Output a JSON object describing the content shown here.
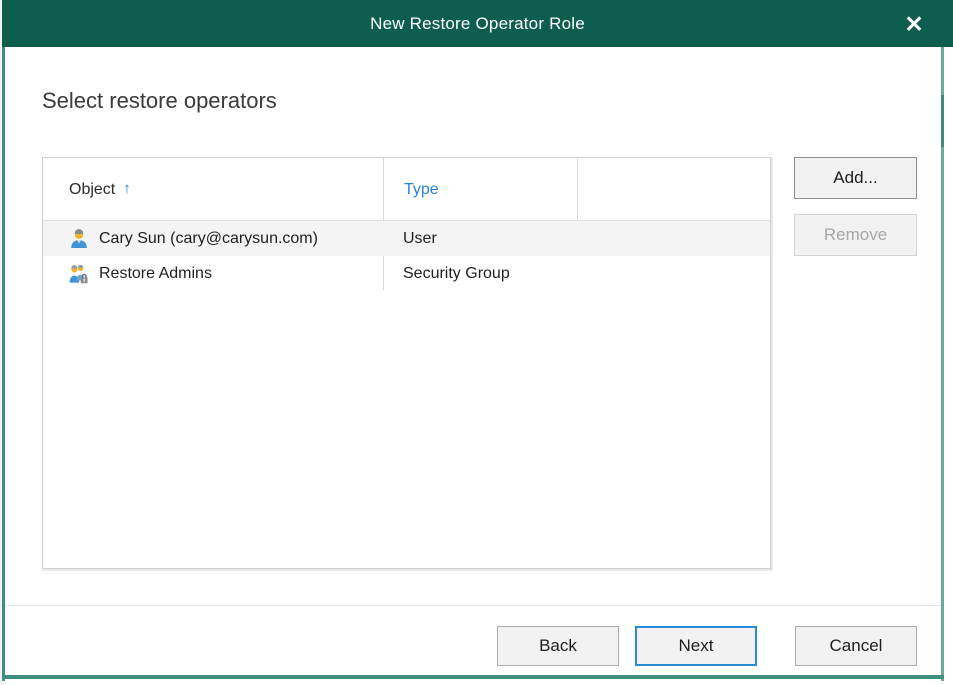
{
  "window": {
    "title": "New Restore Operator Role",
    "close_label": "✕"
  },
  "page": {
    "heading": "Select restore operators"
  },
  "table": {
    "columns": [
      {
        "label": "Object",
        "sort": "asc",
        "sort_glyph": "↑"
      },
      {
        "label": "Type"
      },
      {
        "label": ""
      }
    ],
    "rows": [
      {
        "icon": "user-icon",
        "object": "Cary Sun (cary@carysun.com)",
        "type": "User",
        "selected": true
      },
      {
        "icon": "security-group-icon",
        "object": "Restore Admins",
        "type": "Security Group",
        "selected": false
      }
    ]
  },
  "side_buttons": {
    "add_label": "Add...",
    "remove_label": "Remove"
  },
  "footer": {
    "back_label": "Back",
    "next_label": "Next",
    "cancel_label": "Cancel"
  },
  "colors": {
    "titlebar": "#0d5e4f",
    "frame": "#3f8f80",
    "accent_blue": "#2585d6",
    "default_button_border": "#2f8ad6",
    "selection": "#f4f4f4",
    "disabled_text": "#a6a6a6"
  }
}
